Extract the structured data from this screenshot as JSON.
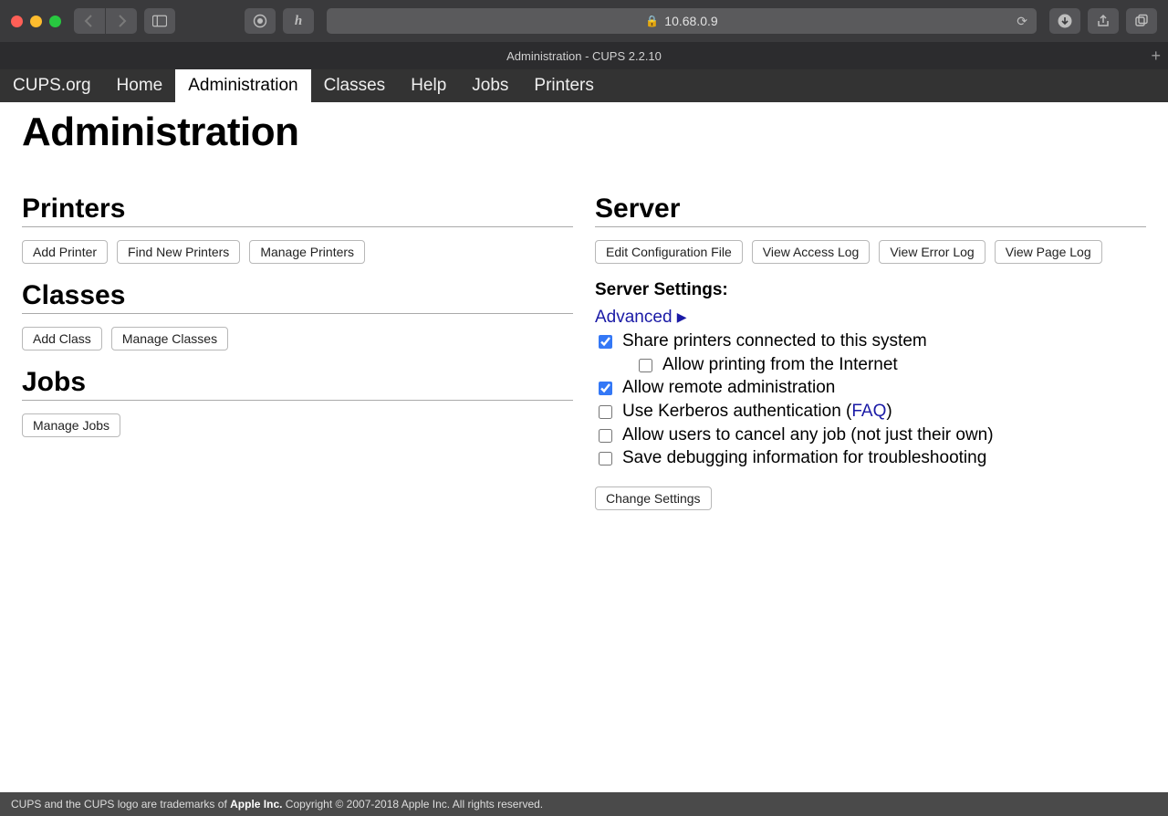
{
  "browser": {
    "url_host": "10.68.0.9",
    "tab_title": "Administration - CUPS 2.2.10"
  },
  "nav": {
    "items": [
      {
        "label": "CUPS.org"
      },
      {
        "label": "Home"
      },
      {
        "label": "Administration"
      },
      {
        "label": "Classes"
      },
      {
        "label": "Help"
      },
      {
        "label": "Jobs"
      },
      {
        "label": "Printers"
      }
    ],
    "active_index": 2
  },
  "page": {
    "title": "Administration"
  },
  "printers": {
    "heading": "Printers",
    "buttons": [
      "Add Printer",
      "Find New Printers",
      "Manage Printers"
    ]
  },
  "classes": {
    "heading": "Classes",
    "buttons": [
      "Add Class",
      "Manage Classes"
    ]
  },
  "jobs": {
    "heading": "Jobs",
    "buttons": [
      "Manage Jobs"
    ]
  },
  "server": {
    "heading": "Server",
    "buttons": [
      "Edit Configuration File",
      "View Access Log",
      "View Error Log",
      "View Page Log"
    ],
    "settings_heading": "Server Settings:",
    "advanced_label": "Advanced",
    "options": [
      {
        "label": "Share printers connected to this system",
        "checked": true,
        "indent": false
      },
      {
        "label": "Allow printing from the Internet",
        "checked": false,
        "indent": true
      },
      {
        "label": "Allow remote administration",
        "checked": true,
        "indent": false
      },
      {
        "label_pre": "Use Kerberos authentication (",
        "faq": "FAQ",
        "label_post": ")",
        "checked": false,
        "indent": false,
        "has_faq": true
      },
      {
        "label": "Allow users to cancel any job (not just their own)",
        "checked": false,
        "indent": false
      },
      {
        "label": "Save debugging information for troubleshooting",
        "checked": false,
        "indent": false
      }
    ],
    "change_button": "Change Settings"
  },
  "footer": {
    "pre": "CUPS and the CUPS logo are trademarks of ",
    "owner": "Apple Inc.",
    "post": " Copyright © 2007-2018 Apple Inc. All rights reserved."
  }
}
